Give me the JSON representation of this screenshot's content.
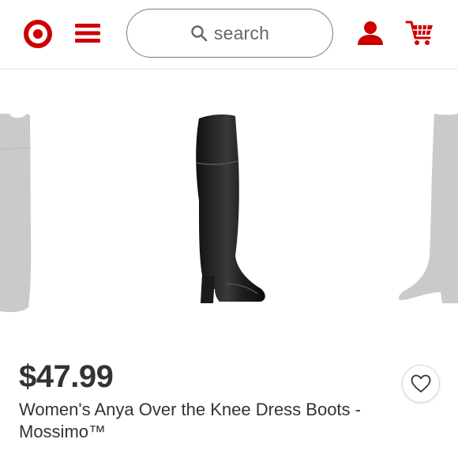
{
  "header": {
    "search_placeholder": "search",
    "brand_color": "#cc0000",
    "icons": [
      "target-logo-icon",
      "menu-icon",
      "search-icon",
      "account-icon",
      "cart-icon"
    ]
  },
  "product": {
    "price": "$47.99",
    "title": "Women's Anya Over the Knee Dress Boots - Mossimo™"
  },
  "carousel": {
    "favorite_icon": "heart-icon"
  }
}
